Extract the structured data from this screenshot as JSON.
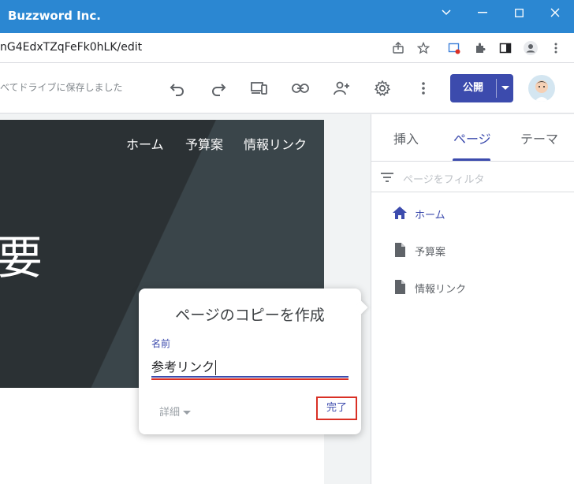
{
  "window": {
    "title": "Buzzword Inc."
  },
  "browser": {
    "url": "nG4EdxTZqFeFk0hLK/edit"
  },
  "toolbar": {
    "save_status": "べてドライブに保存しました",
    "publish_label": "公開"
  },
  "site_page": {
    "nav": [
      "ホーム",
      "予算案",
      "情報リンク"
    ],
    "hero_text": "要"
  },
  "side_panel": {
    "tabs": [
      {
        "label": "挿入",
        "active": false
      },
      {
        "label": "ページ",
        "active": true
      },
      {
        "label": "テーマ",
        "active": false
      }
    ],
    "filter_placeholder": "ページをフィルタ",
    "pages": [
      {
        "label": "ホーム",
        "icon": "home-icon",
        "active": true
      },
      {
        "label": "予算案",
        "icon": "page-icon",
        "active": false
      },
      {
        "label": "情報リンク",
        "icon": "page-icon",
        "active": false
      }
    ]
  },
  "dialog": {
    "title": "ページのコピーを作成",
    "name_label": "名前",
    "name_value": "参考リンク",
    "details_label": "詳細",
    "done_label": "完了"
  },
  "colors": {
    "titlebar": "#2b87d2",
    "accent": "#3c4bad",
    "highlight": "#d93025"
  }
}
